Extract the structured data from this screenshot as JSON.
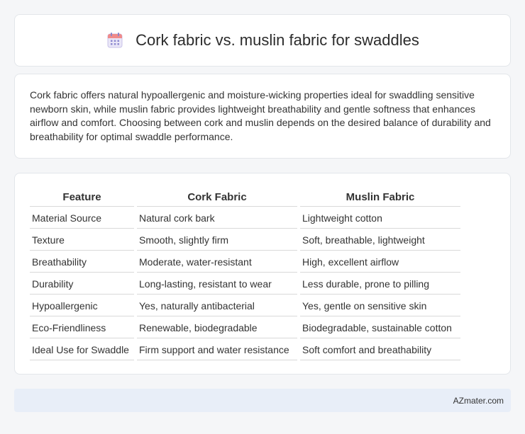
{
  "header": {
    "icon": "calendar-icon",
    "title": "Cork fabric vs. muslin fabric for swaddles"
  },
  "summary": {
    "text": "Cork fabric offers natural hypoallergenic and moisture-wicking properties ideal for swaddling sensitive newborn skin, while muslin fabric provides lightweight breathability and gentle softness that enhances airflow and comfort. Choosing between cork and muslin depends on the desired balance of durability and breathability for optimal swaddle performance."
  },
  "table": {
    "headers": [
      "Feature",
      "Cork Fabric",
      "Muslin Fabric"
    ],
    "rows": [
      [
        "Material Source",
        "Natural cork bark",
        "Lightweight cotton"
      ],
      [
        "Texture",
        "Smooth, slightly firm",
        "Soft, breathable, lightweight"
      ],
      [
        "Breathability",
        "Moderate, water-resistant",
        "High, excellent airflow"
      ],
      [
        "Durability",
        "Long-lasting, resistant to wear",
        "Less durable, prone to pilling"
      ],
      [
        "Hypoallergenic",
        "Yes, naturally antibacterial",
        "Yes, gentle on sensitive skin"
      ],
      [
        "Eco-Friendliness",
        "Renewable, biodegradable",
        "Biodegradable, sustainable cotton"
      ],
      [
        "Ideal Use for Swaddle",
        "Firm support and water resistance",
        "Soft comfort and breathability"
      ]
    ]
  },
  "footer": {
    "text": "AZmater.com"
  }
}
